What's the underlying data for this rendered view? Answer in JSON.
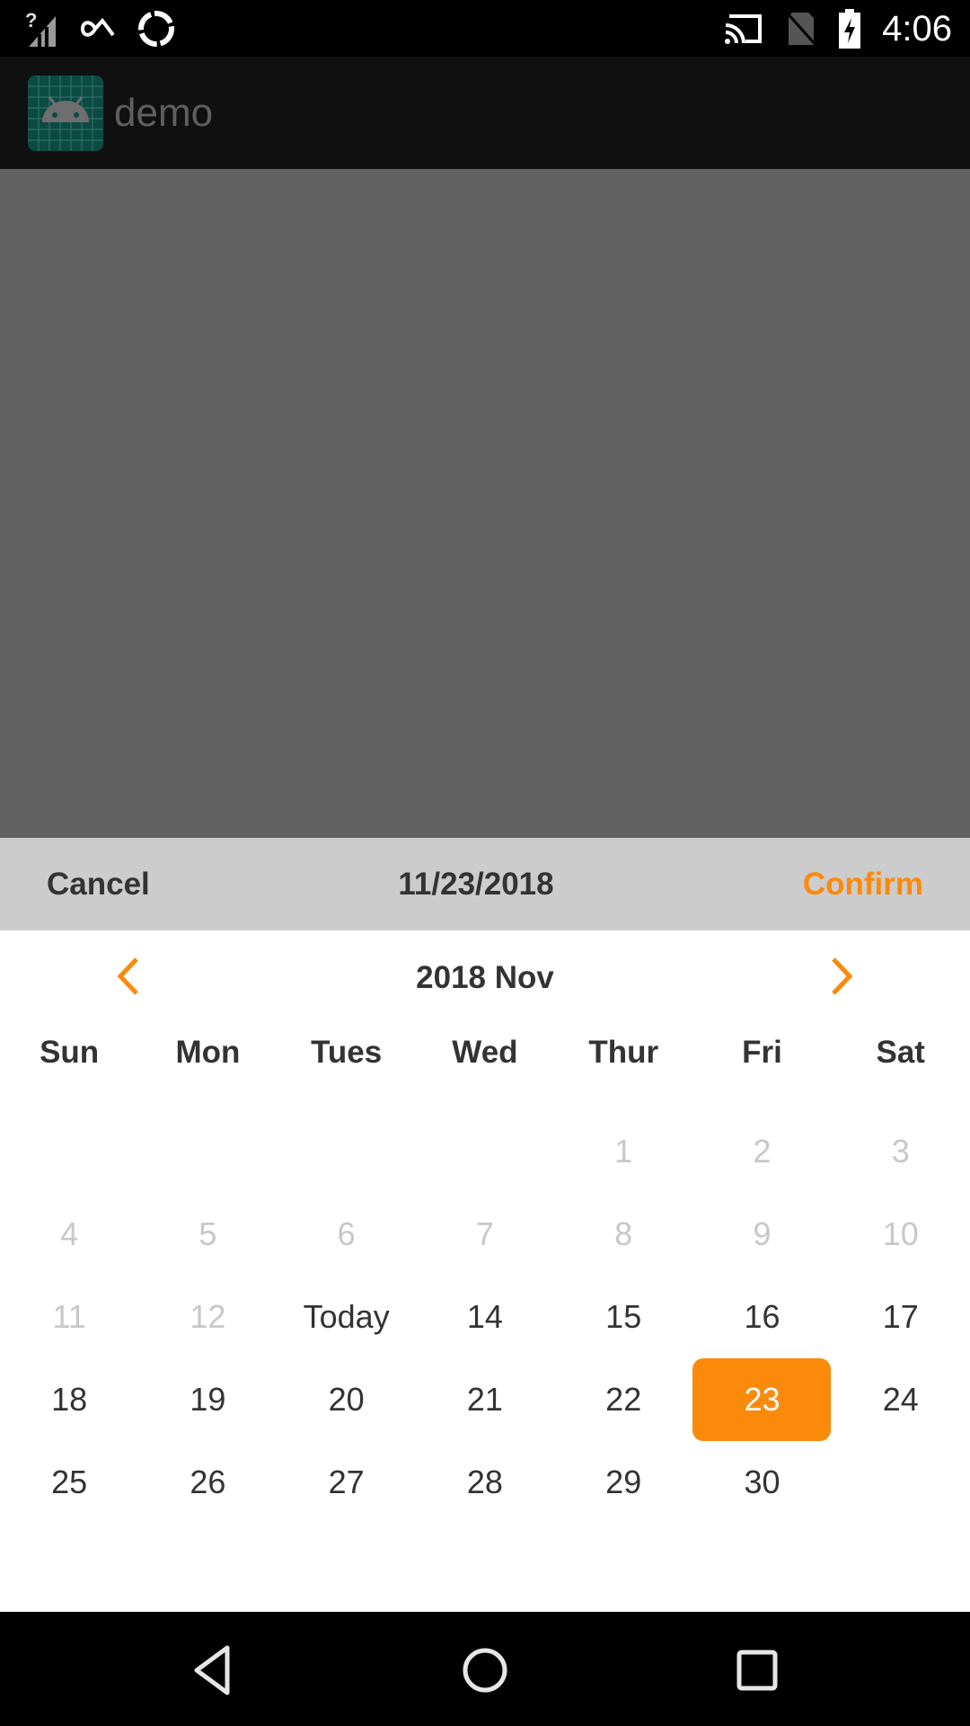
{
  "status_bar": {
    "time": "4:06",
    "left_icons": [
      "signal-unknown-icon",
      "infinity-icon",
      "sync-icon"
    ],
    "right_icons": [
      "cast-icon",
      "no-sim-icon",
      "battery-charging-icon"
    ]
  },
  "app_bar": {
    "title": "demo",
    "icon": "android-app-icon"
  },
  "date_picker": {
    "cancel_label": "Cancel",
    "selected_date_text": "11/23/2018",
    "confirm_label": "Confirm",
    "month_title": "2018 Nov",
    "prev_icon": "chevron-left-icon",
    "next_icon": "chevron-right-icon",
    "accent_color": "#fb8a0b",
    "weekdays": [
      "Sun",
      "Mon",
      "Tues",
      "Wed",
      "Thur",
      "Fri",
      "Sat"
    ],
    "weeks": [
      [
        {
          "label": ""
        },
        {
          "label": ""
        },
        {
          "label": ""
        },
        {
          "label": ""
        },
        {
          "label": "1",
          "state": "disabled"
        },
        {
          "label": "2",
          "state": "disabled"
        },
        {
          "label": "3",
          "state": "disabled"
        }
      ],
      [
        {
          "label": "4",
          "state": "disabled"
        },
        {
          "label": "5",
          "state": "disabled"
        },
        {
          "label": "6",
          "state": "disabled"
        },
        {
          "label": "7",
          "state": "disabled"
        },
        {
          "label": "8",
          "state": "disabled"
        },
        {
          "label": "9",
          "state": "disabled"
        },
        {
          "label": "10",
          "state": "disabled"
        }
      ],
      [
        {
          "label": "11",
          "state": "disabled"
        },
        {
          "label": "12",
          "state": "disabled"
        },
        {
          "label": "Today",
          "state": "today"
        },
        {
          "label": "14",
          "state": "enabled"
        },
        {
          "label": "15",
          "state": "enabled"
        },
        {
          "label": "16",
          "state": "enabled"
        },
        {
          "label": "17",
          "state": "enabled"
        }
      ],
      [
        {
          "label": "18",
          "state": "enabled"
        },
        {
          "label": "19",
          "state": "enabled"
        },
        {
          "label": "20",
          "state": "enabled"
        },
        {
          "label": "21",
          "state": "enabled"
        },
        {
          "label": "22",
          "state": "enabled"
        },
        {
          "label": "23",
          "state": "selected"
        },
        {
          "label": "24",
          "state": "enabled"
        }
      ],
      [
        {
          "label": "25",
          "state": "enabled"
        },
        {
          "label": "26",
          "state": "enabled"
        },
        {
          "label": "27",
          "state": "enabled"
        },
        {
          "label": "28",
          "state": "enabled"
        },
        {
          "label": "29",
          "state": "enabled"
        },
        {
          "label": "30",
          "state": "enabled"
        },
        {
          "label": ""
        }
      ]
    ]
  },
  "nav_bar": {
    "buttons": [
      "back-icon",
      "home-icon",
      "recents-icon"
    ]
  }
}
